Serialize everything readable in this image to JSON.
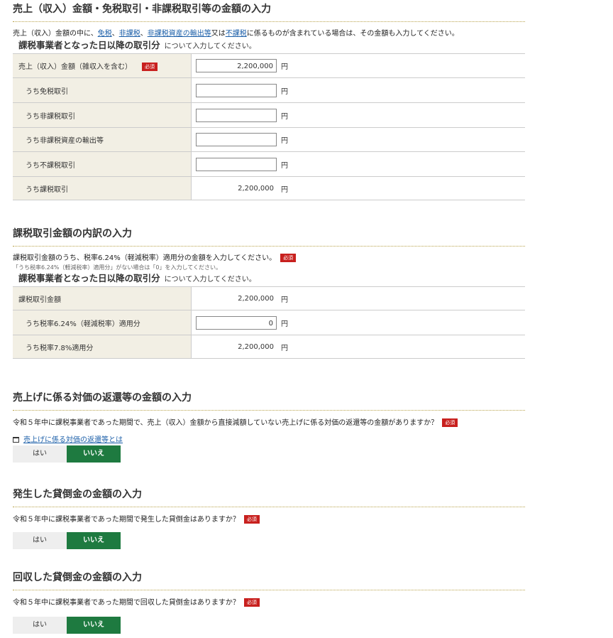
{
  "section1": {
    "title": "売上（収入）金額・免税取引・非課税取引等の金額の入力",
    "desc_pre": "売上（収入）金額の中に、",
    "link1": "免税",
    "sep1": "、",
    "link2": "非課税",
    "sep2": "、",
    "link3": "非課税資産の輸出等",
    "sep3": "又は",
    "link4": "不課税",
    "desc_post": "に係るものが含まれている場合は、その金額も入力してください。",
    "subhead_bold": "課税事業者となった日以降の取引分",
    "subhead_rest": "について入力してください。",
    "required_badge": "必須",
    "rows": [
      {
        "label": "売上（収入）金額（雑収入を含む）",
        "value": "2,200,000",
        "unit": "円"
      },
      {
        "label": "うち免税取引",
        "value": "",
        "unit": "円"
      },
      {
        "label": "うち非課税取引",
        "value": "",
        "unit": "円"
      },
      {
        "label": "うち非課税資産の輸出等",
        "value": "",
        "unit": "円"
      },
      {
        "label": "うち不課税取引",
        "value": "",
        "unit": "円"
      },
      {
        "label": "うち課税取引",
        "value": "2,200,000",
        "unit": "円"
      }
    ]
  },
  "section2": {
    "title": "課税取引金額の内訳の入力",
    "desc": "課税取引金額のうち、税率6.24%（軽減税率）適用分の金額を入力してください。",
    "required_badge": "必須",
    "note": "「うち税率6.24%（軽減税率）適用分」がない場合は「0」を入力してください。",
    "subhead_bold": "課税事業者となった日以降の取引分",
    "subhead_rest": "について入力してください。",
    "rows": [
      {
        "label": "課税取引金額",
        "value": "2,200,000",
        "unit": "円"
      },
      {
        "label": "うち税率6.24%（軽減税率）適用分",
        "value": "0",
        "unit": "円"
      },
      {
        "label": "うち税率7.8%適用分",
        "value": "2,200,000",
        "unit": "円"
      }
    ]
  },
  "section3": {
    "title": "売上げに係る対価の返還等の金額の入力",
    "question": "令和５年中に課税事業者であった期間で、売上（収入）金額から直接減額していない売上げに係る対価の返還等の金額がありますか？",
    "required_badge": "必須",
    "link": "売上げに係る対価の返還等とは",
    "yes": "はい",
    "no": "いいえ"
  },
  "section4": {
    "title": "発生した貸倒金の金額の入力",
    "question": "令和５年中に課税事業者であった期間で発生した貸倒金はありますか？",
    "required_badge": "必須",
    "yes": "はい",
    "no": "いいえ"
  },
  "section5": {
    "title": "回収した貸倒金の金額の入力",
    "question": "令和５年中に課税事業者であった期間で回収した貸倒金はありますか？",
    "required_badge": "必須",
    "yes": "はい",
    "no": "いいえ"
  }
}
